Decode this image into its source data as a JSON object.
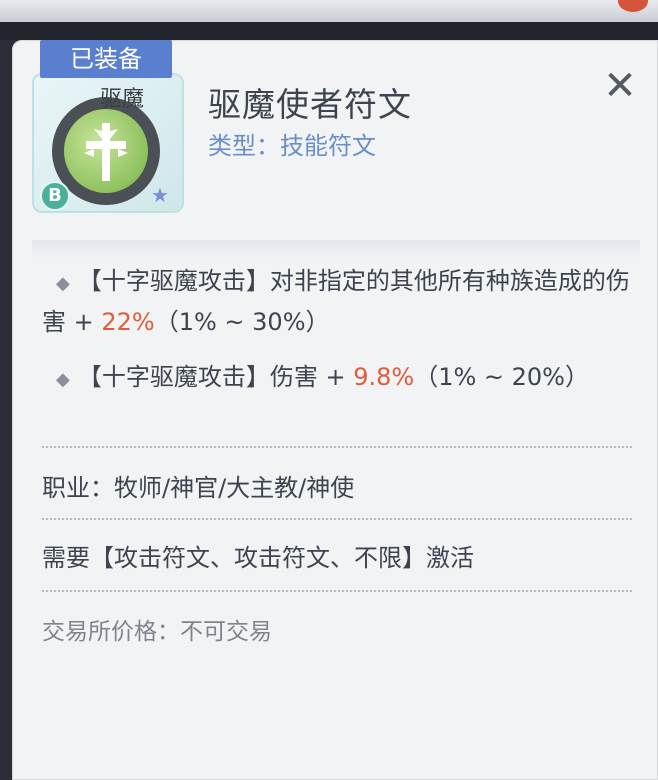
{
  "item": {
    "equipped_tag": "已装备",
    "icon_text": "驱魔",
    "grade": "B",
    "name": "驱魔使者符文",
    "type_label": "类型：",
    "type_value": "技能符文"
  },
  "attributes": [
    {
      "prefix": "【十字驱魔攻击】对非指定的其他所有种族造成的伤害 + ",
      "value": "22%",
      "range": "（1% ~ 30%）"
    },
    {
      "prefix": "【十字驱魔攻击】伤害 + ",
      "value": "9.8%",
      "range": "（1% ~ 20%）"
    }
  ],
  "class_line": "职业：牧师/神官/大主教/神使",
  "require_line": "需要【攻击符文、攻击符文、不限】激活",
  "price_line": "交易所价格：不可交易",
  "colors": {
    "highlight": "#e15b3d",
    "tag": "#5a7fcf",
    "type": "#6a8fc7"
  },
  "icons": {
    "close": "close-icon",
    "star": "star-icon"
  }
}
